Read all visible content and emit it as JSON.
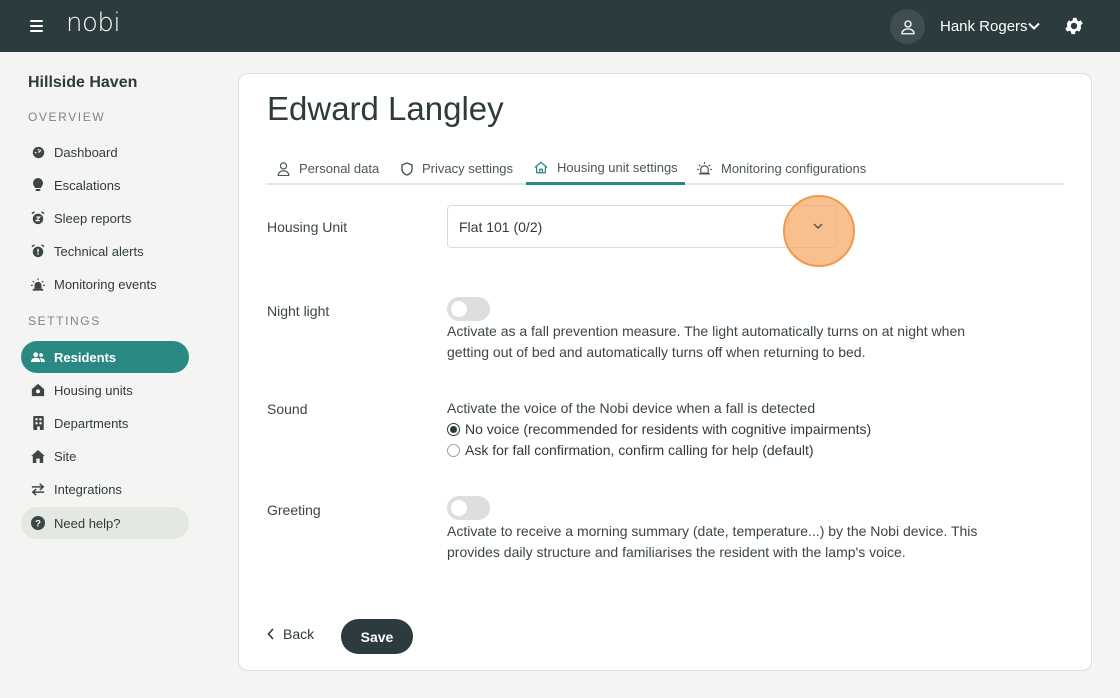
{
  "header": {
    "logo": "nobi",
    "user_name": "Hank Rogers"
  },
  "sidebar": {
    "org_name": "Hillside Haven",
    "overview_label": "OVERVIEW",
    "settings_label": "SETTINGS",
    "overview_items": [
      {
        "label": "Dashboard",
        "icon": "dashboard-icon"
      },
      {
        "label": "Escalations",
        "icon": "escalations-icon"
      },
      {
        "label": "Sleep reports",
        "icon": "sleep-reports-icon"
      },
      {
        "label": "Technical alerts",
        "icon": "technical-alerts-icon"
      },
      {
        "label": "Monitoring events",
        "icon": "monitoring-events-icon"
      }
    ],
    "settings_items": [
      {
        "label": "Residents",
        "icon": "residents-icon",
        "active": true
      },
      {
        "label": "Housing units",
        "icon": "housing-units-icon"
      },
      {
        "label": "Departments",
        "icon": "departments-icon"
      },
      {
        "label": "Site",
        "icon": "site-icon"
      },
      {
        "label": "Integrations",
        "icon": "integrations-icon"
      }
    ],
    "help_label": "Need help?"
  },
  "main": {
    "resident_name": "Edward Langley",
    "tabs": [
      {
        "label": "Personal data",
        "icon": "person-icon"
      },
      {
        "label": "Privacy settings",
        "icon": "shield-icon"
      },
      {
        "label": "Housing unit settings",
        "icon": "home-icon",
        "active": true
      },
      {
        "label": "Monitoring configurations",
        "icon": "alarm-icon"
      }
    ],
    "housing_unit": {
      "label": "Housing Unit",
      "value": "Flat 101 (0/2)"
    },
    "night_light": {
      "label": "Night light",
      "enabled": false,
      "description": "Activate as a fall prevention measure. The light automatically turns on at night when getting out of bed and automatically turns off when returning to bed."
    },
    "sound": {
      "label": "Sound",
      "description": "Activate the voice of the Nobi device when a fall is detected",
      "options": [
        {
          "label": "No voice (recommended for residents with cognitive impairments)",
          "selected": true
        },
        {
          "label": "Ask for fall confirmation, confirm calling for help (default)",
          "selected": false
        }
      ]
    },
    "greeting": {
      "label": "Greeting",
      "enabled": false,
      "description": "Activate to receive a morning summary (date, temperature...) by the Nobi device. This provides daily structure and familiarises the resident with the lamp's voice."
    },
    "back_label": "Back",
    "save_label": "Save"
  },
  "colors": {
    "header_bg": "#2c3b3d",
    "accent": "#2a8a83",
    "highlight": "#f6aa69"
  }
}
